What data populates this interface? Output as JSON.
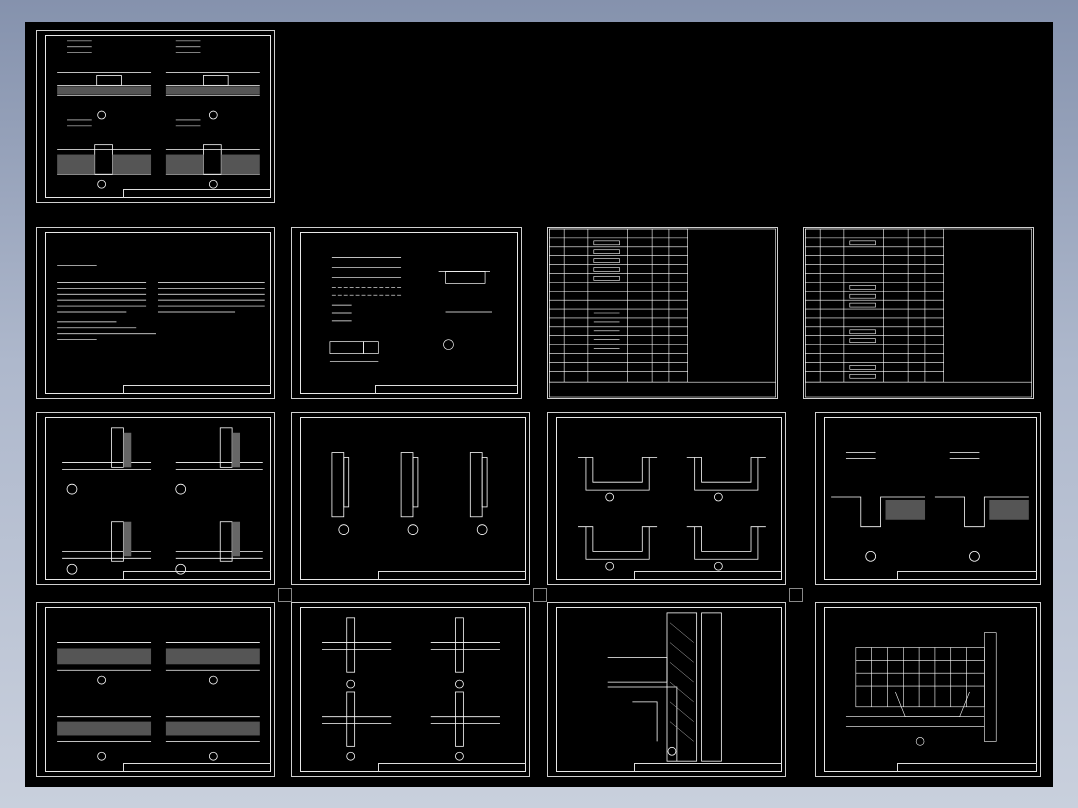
{
  "viewer": {
    "background_gradient": [
      "#8592ad",
      "#c9d0dd"
    ],
    "canvas_color": "#000000",
    "line_color": "#ffffff"
  },
  "sheets": [
    {
      "id": "s1",
      "kind": "section-details"
    },
    {
      "id": "s2",
      "kind": "text-notes"
    },
    {
      "id": "s3",
      "kind": "legend"
    },
    {
      "id": "s4",
      "kind": "material-table"
    },
    {
      "id": "s5",
      "kind": "material-table"
    },
    {
      "id": "s6",
      "kind": "wall-corner-details"
    },
    {
      "id": "s7",
      "kind": "wall-sections"
    },
    {
      "id": "s8",
      "kind": "trench-details"
    },
    {
      "id": "s9",
      "kind": "joint-details"
    },
    {
      "id": "s10",
      "kind": "section-details"
    },
    {
      "id": "s11",
      "kind": "pipe-penetration-details"
    },
    {
      "id": "s12",
      "kind": "wall-slab-junction"
    },
    {
      "id": "s13",
      "kind": "tiled-pit-detail"
    }
  ]
}
